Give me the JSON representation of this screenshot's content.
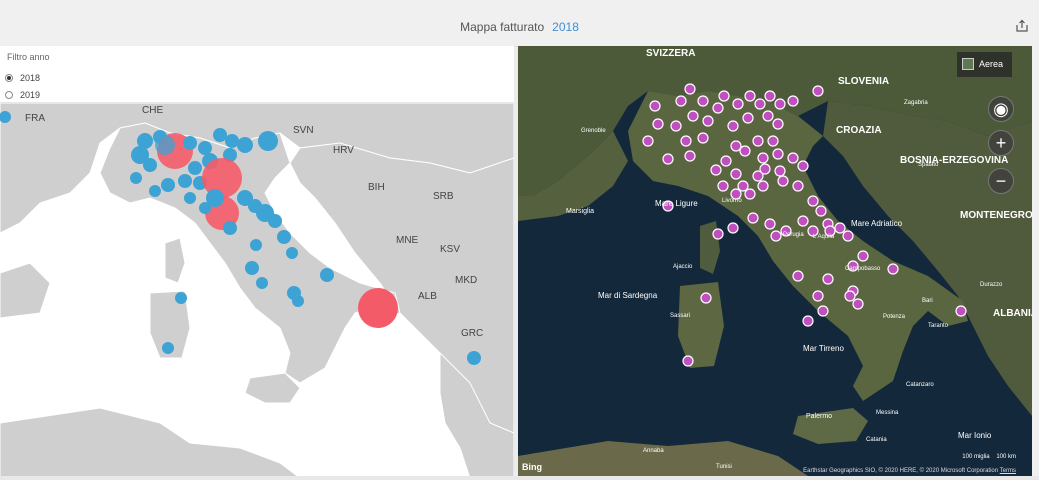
{
  "header": {
    "title": "Mappa fatturato",
    "year": "2018"
  },
  "filter": {
    "title": "Filtro anno",
    "options": [
      {
        "label": "2018",
        "selected": true
      },
      {
        "label": "2019",
        "selected": false
      }
    ]
  },
  "left_map": {
    "country_labels": [
      "FRA",
      "CHE",
      "SVN",
      "HRV",
      "BIH",
      "SRB",
      "MNE",
      "KSV",
      "MKD",
      "ALB",
      "GRC"
    ],
    "colors": {
      "bubble_blue": "#3da3d4",
      "bubble_red": "#f45b69",
      "land": "#cfcfcf",
      "sea": "#ffffff"
    }
  },
  "right_map": {
    "labels": {
      "svizzera": "SVIZZERA",
      "slovenia": "SLOVENIA",
      "croazia": "CROAZIA",
      "bosnia": "BOSNIA-ERZEGOVINA",
      "montenegro": "MONTENEGRO",
      "albania": "ALBANIA",
      "mare_ligure": "Mare Ligure",
      "mare_adriatico": "Mare Adriatico",
      "mar_di_sardegna": "Mar di Sardegna",
      "mar_tirreno": "Mar Tirreno",
      "mar_ionio": "Mar Ionio",
      "marsiglia": "Marsiglia",
      "grenoble": "Grenoble",
      "ajaccio": "Ajaccio",
      "sassari": "Sassari",
      "livorno": "Livorno",
      "perugia": "Perugia",
      "laquila": "L'Aquila",
      "campobasso": "Campobasso",
      "bari": "Bari",
      "taranto": "Taranto",
      "potenza": "Potenza",
      "catanzaro": "Catanzaro",
      "palermo": "Palermo",
      "messina": "Messina",
      "catania": "Catania",
      "annaba": "Annaba",
      "tunisi": "Tunisi",
      "zagabria": "Zagabria",
      "spalato": "Spalato",
      "durazzo": "Durazzo"
    },
    "view_button": "Aerea",
    "scale_miles": "100 miglia",
    "scale_km": "100 km",
    "copyright": "Earthstar Geographics SIO, © 2020 HERE, © 2020 Microsoft Corporation",
    "terms": "Terms",
    "brand": "Bing",
    "pin_color": "#c04fc0"
  }
}
